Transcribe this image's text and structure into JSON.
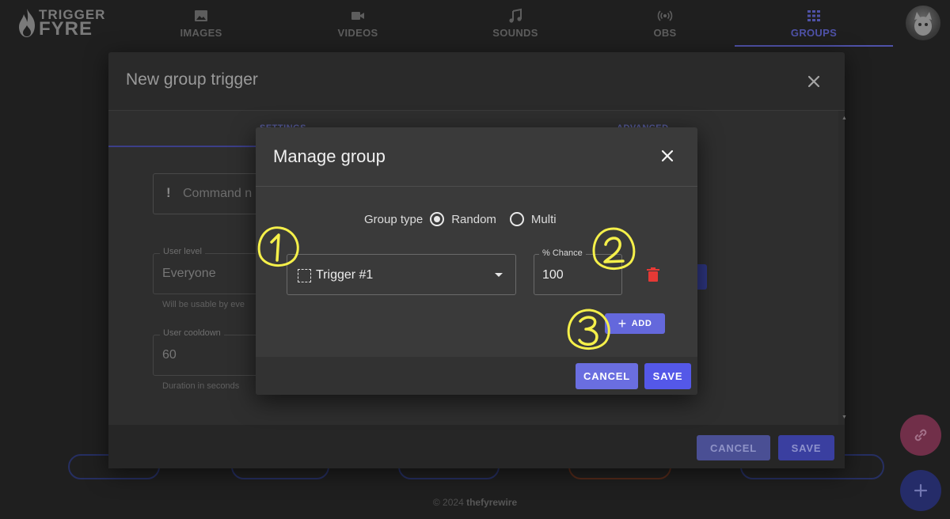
{
  "logo": {
    "line1": "TRIGGER",
    "line2": "FYRE"
  },
  "nav": [
    {
      "label": "IMAGES",
      "icon": "image-icon"
    },
    {
      "label": "VIDEOS",
      "icon": "video-icon"
    },
    {
      "label": "SOUNDS",
      "icon": "music-icon"
    },
    {
      "label": "OBS",
      "icon": "broadcast-icon"
    },
    {
      "label": "GROUPS",
      "icon": "grid-icon",
      "active": true
    }
  ],
  "colors": {
    "accent": "#6468dc",
    "delete": "#e53935",
    "annotation": "#f5f04a"
  },
  "outer_dialog": {
    "title": "New group trigger",
    "tabs": [
      "SETTINGS",
      "ADVANCED"
    ],
    "command_placeholder": "Command n",
    "user_level": {
      "label": "User level",
      "value": "Everyone",
      "helper": "Will be usable by eve"
    },
    "user_cooldown": {
      "label": "User cooldown",
      "value": "60",
      "helper": "Duration in seconds"
    },
    "cancel_label": "CANCEL",
    "save_label": "SAVE"
  },
  "manage_group": {
    "title": "Manage group",
    "group_type_label": "Group type",
    "options": [
      {
        "label": "Random",
        "selected": true
      },
      {
        "label": "Multi",
        "selected": false
      }
    ],
    "trigger_select_value": "Trigger #1",
    "chance_label": "% Chance",
    "chance_value": "100",
    "add_label": "ADD",
    "cancel_label": "CANCEL",
    "save_label": "SAVE"
  },
  "annotations": [
    "1",
    "2",
    "3"
  ],
  "footer": {
    "copyright_prefix": "© 2024",
    "copyright_name": "thefyrewire"
  }
}
